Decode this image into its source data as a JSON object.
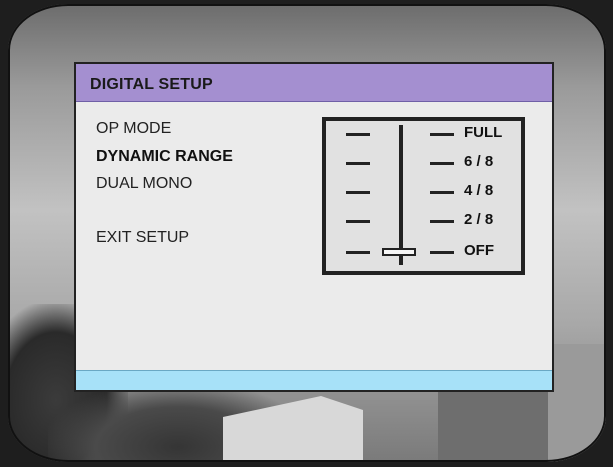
{
  "menu": {
    "title": "DIGITAL SETUP",
    "items": [
      {
        "label": "OP MODE",
        "active": false
      },
      {
        "label": "DYNAMIC RANGE",
        "active": true
      },
      {
        "label": "DUAL MONO",
        "active": false
      },
      {
        "label": "EXIT SETUP",
        "active": false
      }
    ]
  },
  "dynamic_range_scale": {
    "levels": [
      "FULL",
      "6 / 8",
      "4 / 8",
      "2 / 8",
      "OFF"
    ],
    "selected": "OFF"
  },
  "colors": {
    "title_bar": "#a48fd0",
    "bottom_bar": "#a7e1f8",
    "panel": "#ebebeb"
  }
}
